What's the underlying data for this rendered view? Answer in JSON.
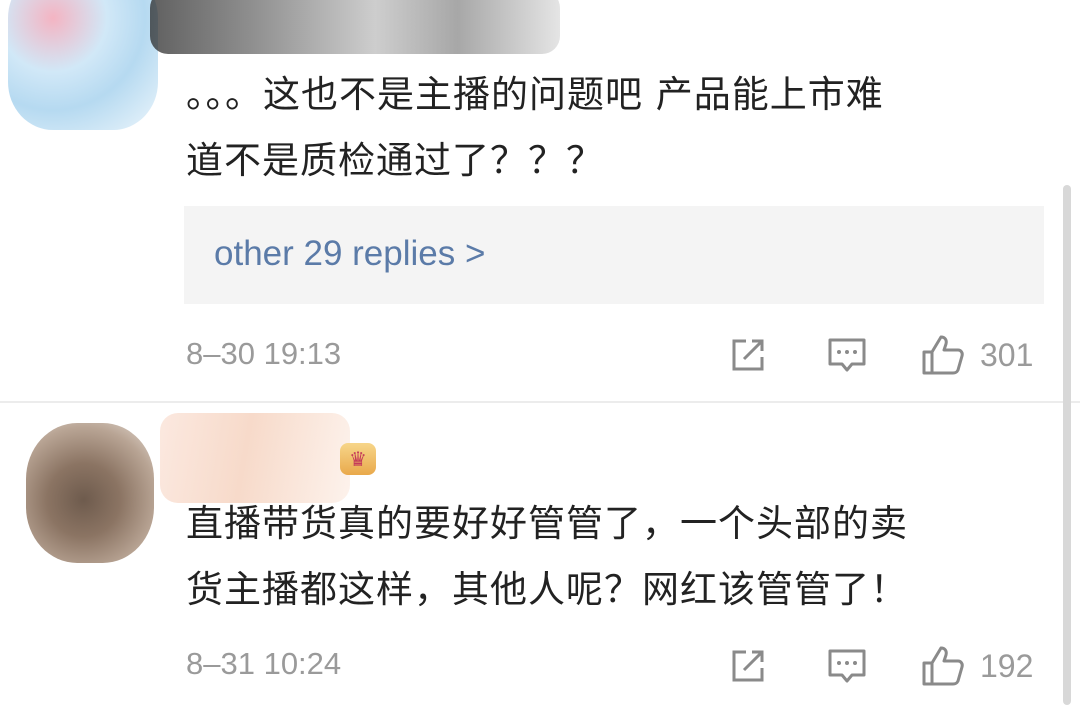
{
  "comments": [
    {
      "text_line1": "。。。这也不是主播的问题吧 产品能上市难",
      "text_line2": "道不是质检通过了？？？",
      "replies_label": "other 29 replies >",
      "timestamp": "8–30 19:13",
      "like_count": "301"
    },
    {
      "text_line1": "直播带货真的要好好管管了，一个头部的卖",
      "text_line2": "货主播都这样，其他人呢？网红该管管了！",
      "timestamp": "8–31 10:24",
      "like_count": "192"
    }
  ],
  "icons": {
    "share": "share-icon",
    "comment": "comment-icon",
    "like": "thumbs-up-icon",
    "vip": "crown-badge-icon"
  },
  "colors": {
    "link": "#5b7ba8",
    "meta": "#9a9a9a",
    "text": "#222222",
    "reply_bg": "#f4f4f4"
  }
}
